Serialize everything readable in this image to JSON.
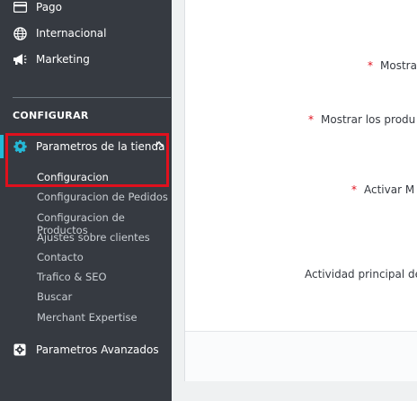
{
  "sidebar": {
    "top_items": [
      {
        "label": "Pago",
        "icon": "credit-card-icon"
      },
      {
        "label": "Internacional",
        "icon": "globe-icon"
      },
      {
        "label": "Marketing",
        "icon": "megaphone-icon"
      }
    ],
    "section_title": "CONFIGURAR",
    "active_item": {
      "label": "Parametros de la tienda",
      "icon": "gear-icon"
    },
    "sub_items": [
      {
        "label": "Configuracion"
      },
      {
        "label": "Configuracion de Pedidos"
      },
      {
        "label": "Configuracion de Productos"
      },
      {
        "label": "Ajustes sobre clientes"
      },
      {
        "label": "Contacto"
      },
      {
        "label": "Trafico & SEO"
      },
      {
        "label": "Buscar"
      },
      {
        "label": "Merchant Expertise"
      }
    ],
    "advanced_item": {
      "label": "Parametros Avanzados",
      "icon": "cog-box-icon"
    }
  },
  "main": {
    "fields": [
      {
        "label": "Mostra",
        "required": true
      },
      {
        "label": "Mostrar los produ",
        "required": true
      },
      {
        "label": "Activar M",
        "required": true
      },
      {
        "label": "Actividad principal de",
        "required": false
      }
    ],
    "required_marker": "*"
  },
  "colors": {
    "sidebar_bg": "#363a41",
    "accent": "#25b9d7",
    "highlight": "#e0101d"
  }
}
